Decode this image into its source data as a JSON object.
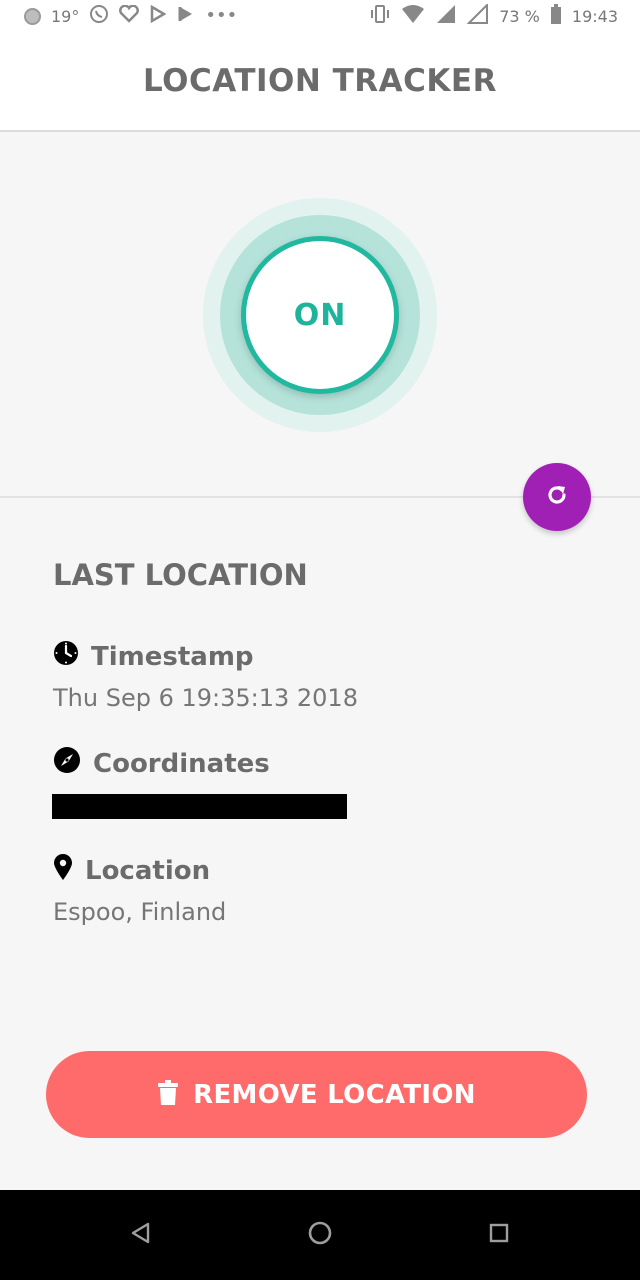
{
  "status_bar": {
    "temperature": "19°",
    "battery": "73 %",
    "time": "19:43"
  },
  "header": {
    "title": "LOCATION TRACKER"
  },
  "toggle": {
    "label": "ON",
    "state": "on",
    "color": "#1fb39b"
  },
  "refresh": {
    "icon": "refresh-icon",
    "color": "#a01fb5"
  },
  "last_location": {
    "title": "LAST LOCATION",
    "timestamp_label": "Timestamp",
    "timestamp_value": "Thu Sep  6 19:35:13 2018",
    "coordinates_label": "Coordinates",
    "location_label": "Location",
    "location_value": "Espoo, Finland"
  },
  "remove_button": {
    "label": "REMOVE LOCATION",
    "icon": "trash-icon",
    "color": "#ff6b6b"
  },
  "nav": {
    "back_icon": "back-icon",
    "home_icon": "home-icon",
    "recents_icon": "recents-icon"
  }
}
